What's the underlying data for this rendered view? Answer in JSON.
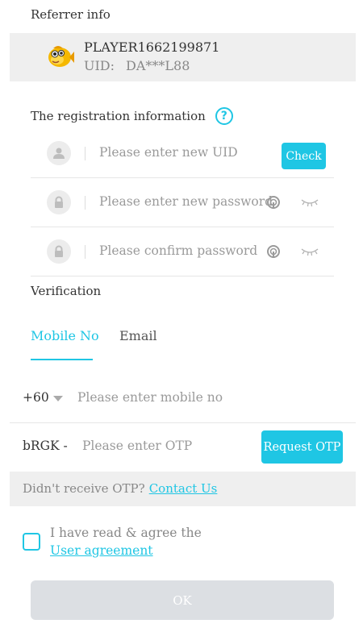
{
  "referrer": {
    "title": "Referrer info",
    "name": "PLAYER1662199871",
    "uid_label": "UID:",
    "uid_value": "DA***L88",
    "avatar_icon": "fish-avatar-icon"
  },
  "registration": {
    "title": "The registration information",
    "help_icon": "?",
    "uid_placeholder": "Please enter new UID",
    "check_label": "Check",
    "password_placeholder": "Please enter new password",
    "confirm_placeholder": "Please confirm password"
  },
  "verification": {
    "title": "Verification",
    "tabs": [
      {
        "label": "Mobile No",
        "active": true
      },
      {
        "label": "Email",
        "active": false
      }
    ],
    "country_code": "+60",
    "mobile_placeholder": "Please enter mobile no",
    "captcha": "bRGK -",
    "otp_placeholder": "Please enter OTP",
    "request_otp_label": "Request OTP",
    "no_otp_text": "Didn't receive OTP?",
    "contact_label": "Contact Us"
  },
  "agreement": {
    "text": "I have read & agree the",
    "link": "User agreement",
    "checked": false
  },
  "ok_label": "OK",
  "colors": {
    "accent": "#1fc6e4",
    "disabled_button": "#dcdfe3",
    "panel_bg": "#efefef"
  }
}
